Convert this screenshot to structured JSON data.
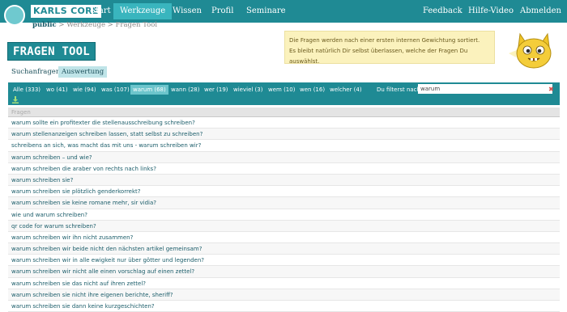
{
  "logo": {
    "text": "KARLS CORE"
  },
  "nav": {
    "items": [
      {
        "label": "Start"
      },
      {
        "label": "Werkzeuge"
      },
      {
        "label": "Wissen"
      },
      {
        "label": "Profil"
      },
      {
        "label": "Seminare"
      }
    ],
    "right_items": [
      {
        "label": "Feedback"
      },
      {
        "label": "Hilfe-Video"
      },
      {
        "label": "Abmelden"
      }
    ]
  },
  "breadcrumb": {
    "root": "public",
    "rest": " > Werkzeuge > Fragen Tool"
  },
  "page": {
    "title": "FRAGEN TOOL"
  },
  "subtabs": [
    {
      "label": "Suchanfragen"
    },
    {
      "label": "Auswertung"
    }
  ],
  "info": {
    "line1": "Die Fragen werden nach einer ersten internen Gewichtung sortiert.",
    "line2": "Es bleibt natürlich Dir selbst überlassen, welche der Fragen Du auswählst."
  },
  "filters": [
    {
      "label": "Alle (333)"
    },
    {
      "label": "wo (41)"
    },
    {
      "label": "wie (94)"
    },
    {
      "label": "was (107)"
    },
    {
      "label": "warum (68)"
    },
    {
      "label": "wann (28)"
    },
    {
      "label": "wer (19)"
    },
    {
      "label": "wieviel (3)"
    },
    {
      "label": "wem (10)"
    },
    {
      "label": "wen (16)"
    },
    {
      "label": "welcher (4)"
    }
  ],
  "filter_label": "Du filterst nach:",
  "filter_value": "warum",
  "filter_clear": "✖",
  "table": {
    "header": "Fragen",
    "rows": [
      "warum sollte ein profitexter die stellenausschreibung schreiben?",
      "warum stellenanzeigen schreiben lassen, statt selbst zu schreiben?",
      "schreibens an sich, was macht das mit uns - warum schreiben wir?",
      "warum schreiben – und wie?",
      "warum schreiben die araber von rechts nach links?",
      "warum schreiben sie?",
      "warum schreiben sie plötzlich genderkorrekt?",
      "warum schreiben sie keine romane mehr, sir vidia?",
      "wie und warum schreiben?",
      "qr code for warum schreiben?",
      "warum schreiben wir ihn nicht zusammen?",
      "warum schreiben wir beide nicht den nächsten artikel gemeinsam?",
      "warum schreiben wir in alle ewigkeit nur über götter und legenden?",
      "warum schreiben wir nicht alle einen vorschlag auf einen zettel?",
      "warum schreiben sie das nicht auf ihren zettel?",
      "warum schreiben sie nicht ihre eigenen berichte, sheriff?",
      "warum schreiben sie dann keine kurzgeschichten?"
    ]
  },
  "colors": {
    "primary": "#1f8a94",
    "active": "#39b5be",
    "info_bg": "#fbf2bd"
  }
}
